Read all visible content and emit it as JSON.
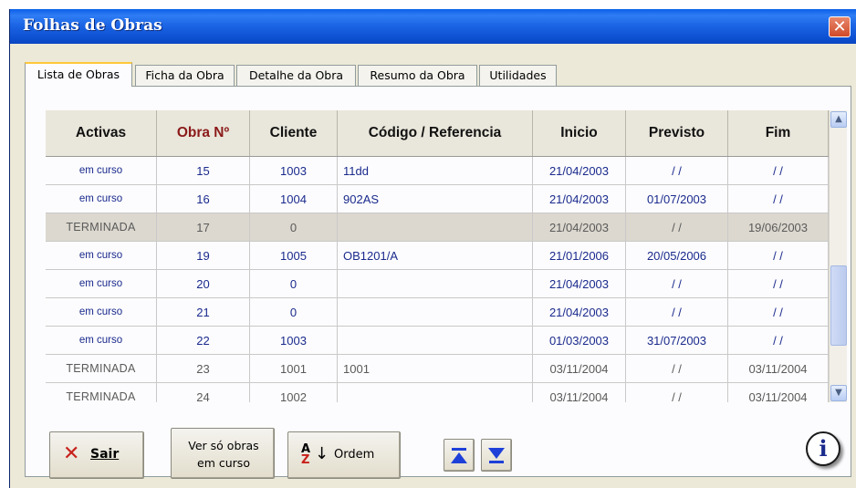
{
  "window": {
    "title": "Folhas de Obras",
    "close_glyph": "✕"
  },
  "tabs": [
    {
      "label": "Lista de Obras",
      "active": true
    },
    {
      "label": "Ficha da Obra",
      "active": false
    },
    {
      "label": "Detalhe da Obra",
      "active": false
    },
    {
      "label": "Resumo da Obra",
      "active": false
    },
    {
      "label": "Utilidades",
      "active": false
    }
  ],
  "table": {
    "columns": [
      "Activas",
      "Obra Nº",
      "Cliente",
      "Código / Referencia",
      "Inicio",
      "Previsto",
      "Fim"
    ],
    "rows": [
      {
        "status": "em curso",
        "obra": "15",
        "cliente": "1003",
        "codigo": "11dd",
        "inicio": "21/04/2003",
        "previsto": "/ /",
        "fim": "/ /",
        "state": "active"
      },
      {
        "status": "em curso",
        "obra": "16",
        "cliente": "1004",
        "codigo": "902AS",
        "inicio": "21/04/2003",
        "previsto": "01/07/2003",
        "fim": "/ /",
        "state": "active"
      },
      {
        "status": "TERMINADA",
        "obra": "17",
        "cliente": "0",
        "codigo": "",
        "inicio": "21/04/2003",
        "previsto": "/ /",
        "fim": "19/06/2003",
        "state": "done",
        "selected": true
      },
      {
        "status": "em curso",
        "obra": "19",
        "cliente": "1005",
        "codigo": "OB1201/A",
        "inicio": "21/01/2006",
        "previsto": "20/05/2006",
        "fim": "/ /",
        "state": "active"
      },
      {
        "status": "em curso",
        "obra": "20",
        "cliente": "0",
        "codigo": "",
        "inicio": "21/04/2003",
        "previsto": "/ /",
        "fim": "/ /",
        "state": "active"
      },
      {
        "status": "em curso",
        "obra": "21",
        "cliente": "0",
        "codigo": "",
        "inicio": "21/04/2003",
        "previsto": "/ /",
        "fim": "/ /",
        "state": "active"
      },
      {
        "status": "em curso",
        "obra": "22",
        "cliente": "1003",
        "codigo": "",
        "inicio": "01/03/2003",
        "previsto": "31/07/2003",
        "fim": "/ /",
        "state": "active"
      },
      {
        "status": "TERMINADA",
        "obra": "23",
        "cliente": "1001",
        "codigo": "1001",
        "inicio": "03/11/2004",
        "previsto": "/ /",
        "fim": "03/11/2004",
        "state": "done"
      },
      {
        "status": "TERMINADA",
        "obra": "24",
        "cliente": "1002",
        "codigo": "",
        "inicio": "03/11/2004",
        "previsto": "/ /",
        "fim": "03/11/2004",
        "state": "done"
      }
    ]
  },
  "scrollbar": {
    "up_glyph": "▲",
    "down_glyph": "▼"
  },
  "buttons": {
    "sair_icon": "✕",
    "sair": "Sair",
    "ver_line1": "Ver só obras",
    "ver_line2": "em curso",
    "ordem_az_top": "A",
    "ordem_az_bottom": "Z",
    "ordem_arrow": "↓",
    "ordem": "Ordem",
    "first_icon": "first-record-icon",
    "last_icon": "last-record-icon"
  },
  "info": {
    "glyph": "i"
  },
  "colors": {
    "title_bar": "#1a63e3",
    "active_text": "#1a2a8c",
    "done_text": "#5a5a5a",
    "obra_header": "#8b1a1a",
    "nav_arrow": "#1e40d8"
  }
}
